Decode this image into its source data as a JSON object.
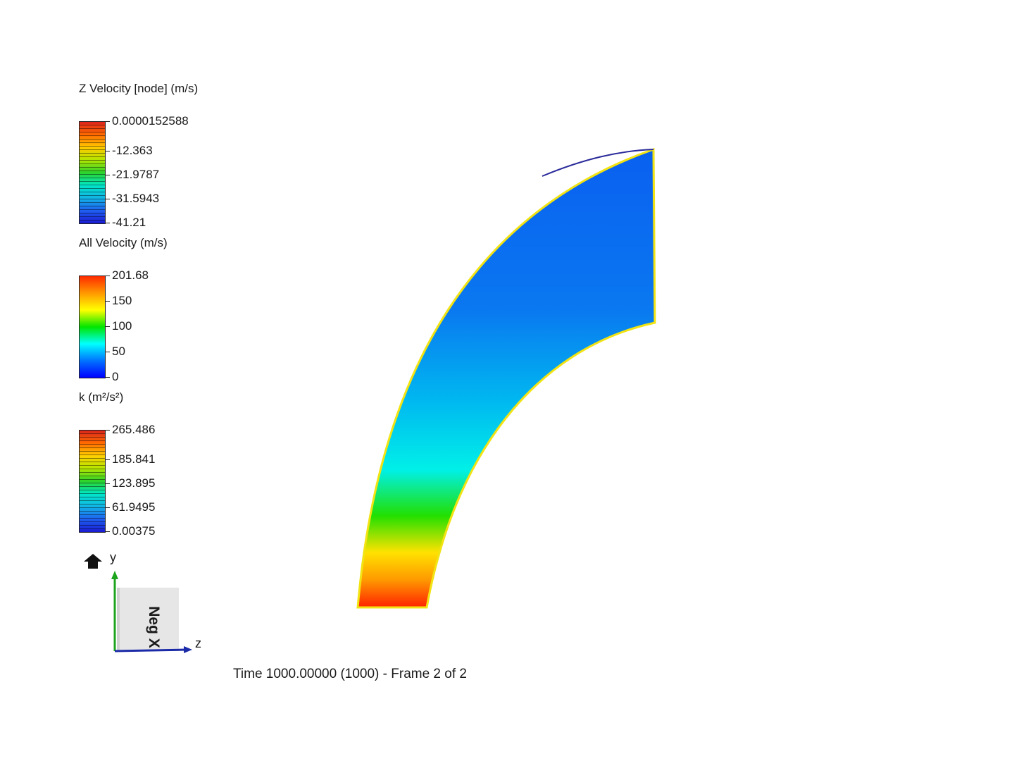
{
  "legends": [
    {
      "title": "Z Velocity [node] (m/s)",
      "ticks": [
        "0.0000152588",
        "-12.363",
        "-21.9787",
        "-31.5943",
        "-41.21"
      ],
      "banded": true,
      "colors": [
        "#e0241b",
        "#ff6a00",
        "#ffc800",
        "#b4e600",
        "#2bd42b",
        "#00e6c8",
        "#12b4e6",
        "#1f5ff0",
        "#1a1ad2"
      ]
    },
    {
      "title": "All Velocity (m/s)",
      "ticks": [
        "201.68",
        "150",
        "100",
        "50",
        "0"
      ],
      "banded": false,
      "colors": [
        "#ff2a00",
        "#ff9900",
        "#ffff00",
        "#00e600",
        "#00ffff",
        "#0073ff",
        "#0000ff"
      ]
    },
    {
      "title": "k (m²/s²)",
      "ticks": [
        "265.486",
        "185.841",
        "123.895",
        "61.9495",
        "0.00375"
      ],
      "banded": true,
      "colors": [
        "#d8261c",
        "#ff6a00",
        "#ffd000",
        "#b4e600",
        "#2bd42b",
        "#00e6c8",
        "#12b4e6",
        "#1f5ff0",
        "#1a1ad2"
      ]
    }
  ],
  "orientation": {
    "cube_face_label": "Neg X",
    "axis_up": "y",
    "axis_right": "z",
    "home_icon": "home-icon"
  },
  "time_label": "Time 1000.00000 (1000) - Frame 2 of 2",
  "field": {
    "outline_color": "#f2e313",
    "gradient": [
      {
        "at": 0.0,
        "color": "#ff2200"
      },
      {
        "at": 0.06,
        "color": "#ff9900"
      },
      {
        "at": 0.12,
        "color": "#ffe200"
      },
      {
        "at": 0.2,
        "color": "#22e000"
      },
      {
        "at": 0.3,
        "color": "#00f0e8"
      },
      {
        "at": 0.45,
        "color": "#00b8f0"
      },
      {
        "at": 0.65,
        "color": "#0a78f0"
      },
      {
        "at": 1.0,
        "color": "#0a60f0"
      }
    ]
  }
}
